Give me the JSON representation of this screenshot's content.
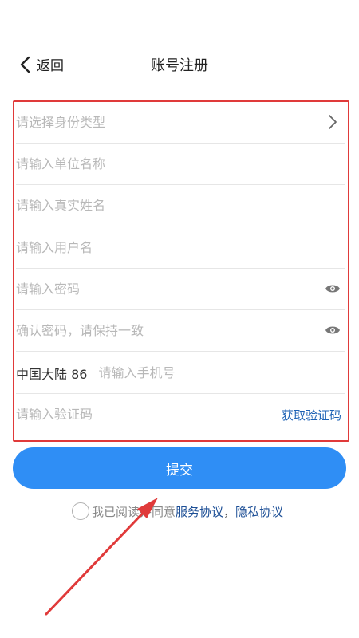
{
  "header": {
    "back_label": "返回",
    "title": "账号注册"
  },
  "form": {
    "identity_type_placeholder": "请选择身份类型",
    "unit_name_placeholder": "请输入单位名称",
    "real_name_placeholder": "请输入真实姓名",
    "username_placeholder": "请输入用户名",
    "password_placeholder": "请输入密码",
    "confirm_password_placeholder": "确认密码，请保持一致",
    "phone_prefix": "中国大陆 86",
    "phone_placeholder": "请输入手机号",
    "code_placeholder": "请输入验证码",
    "get_code_label": "获取验证码"
  },
  "submit_label": "提交",
  "agreement": {
    "text": "我已阅读并同意",
    "service_link": "服务协议",
    "separator": "，",
    "privacy_link": "隐私协议"
  },
  "colors": {
    "accent": "#2f8ef5",
    "link": "#1d4f96",
    "annotation": "#e03a3a"
  },
  "icons": [
    "chevron-left-icon",
    "chevron-right-icon",
    "eye-icon",
    "radio-circle-icon"
  ]
}
